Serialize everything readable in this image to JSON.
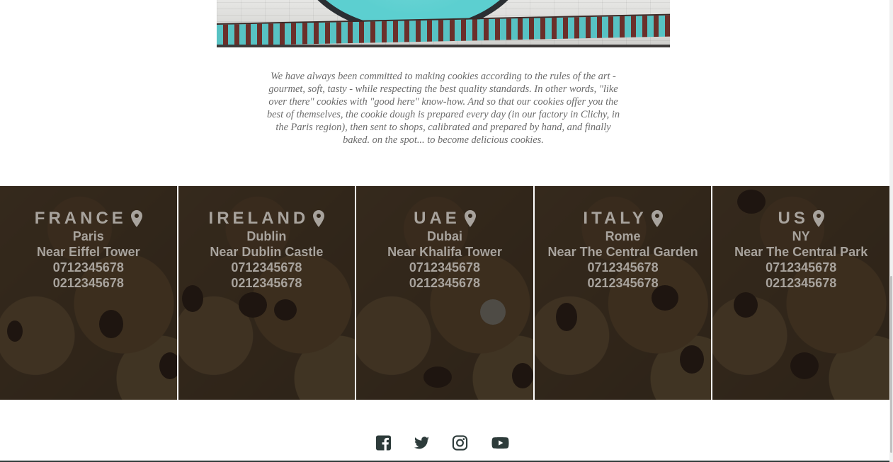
{
  "about": {
    "text": "We have always been committed to making cookies according to the rules of the art - gourmet, soft, tasty - while respecting the best quality standards. In other words, \"like over there\" cookies with \"good here\" know-how. And so that our cookies offer you the best of themselves, the cookie dough is prepared every day (in our factory in Clichy, in the Paris region), then sent to shops, calibrated and prepared by hand, and finally baked. on the spot... to become delicious cookies."
  },
  "locations": [
    {
      "country": "FRANCE",
      "city": "Paris",
      "landmark": "Near Eiffel Tower",
      "phone1": "0712345678",
      "phone2": "0212345678"
    },
    {
      "country": "IRELAND",
      "city": "Dublin",
      "landmark": "Near Dublin Castle",
      "phone1": "0712345678",
      "phone2": "0212345678"
    },
    {
      "country": "UAE",
      "city": "Dubai",
      "landmark": "Near Khalifa Tower",
      "phone1": "0712345678",
      "phone2": "0212345678"
    },
    {
      "country": "ITALY",
      "city": "Rome",
      "landmark": "Near The Central Garden",
      "phone1": "0712345678",
      "phone2": "0212345678"
    },
    {
      "country": "US",
      "city": "NY",
      "landmark": "Near The Central Park",
      "phone1": "0712345678",
      "phone2": "0212345678"
    }
  ],
  "social": {
    "icons": [
      "facebook-square-icon",
      "twitter-icon",
      "instagram-icon",
      "youtube-icon"
    ]
  },
  "colors": {
    "text_overlay": "#a8a39d",
    "about_text": "#6b6b6b",
    "social_icon": "#2d3b3a",
    "accent_teal": "#5ccfd0"
  }
}
